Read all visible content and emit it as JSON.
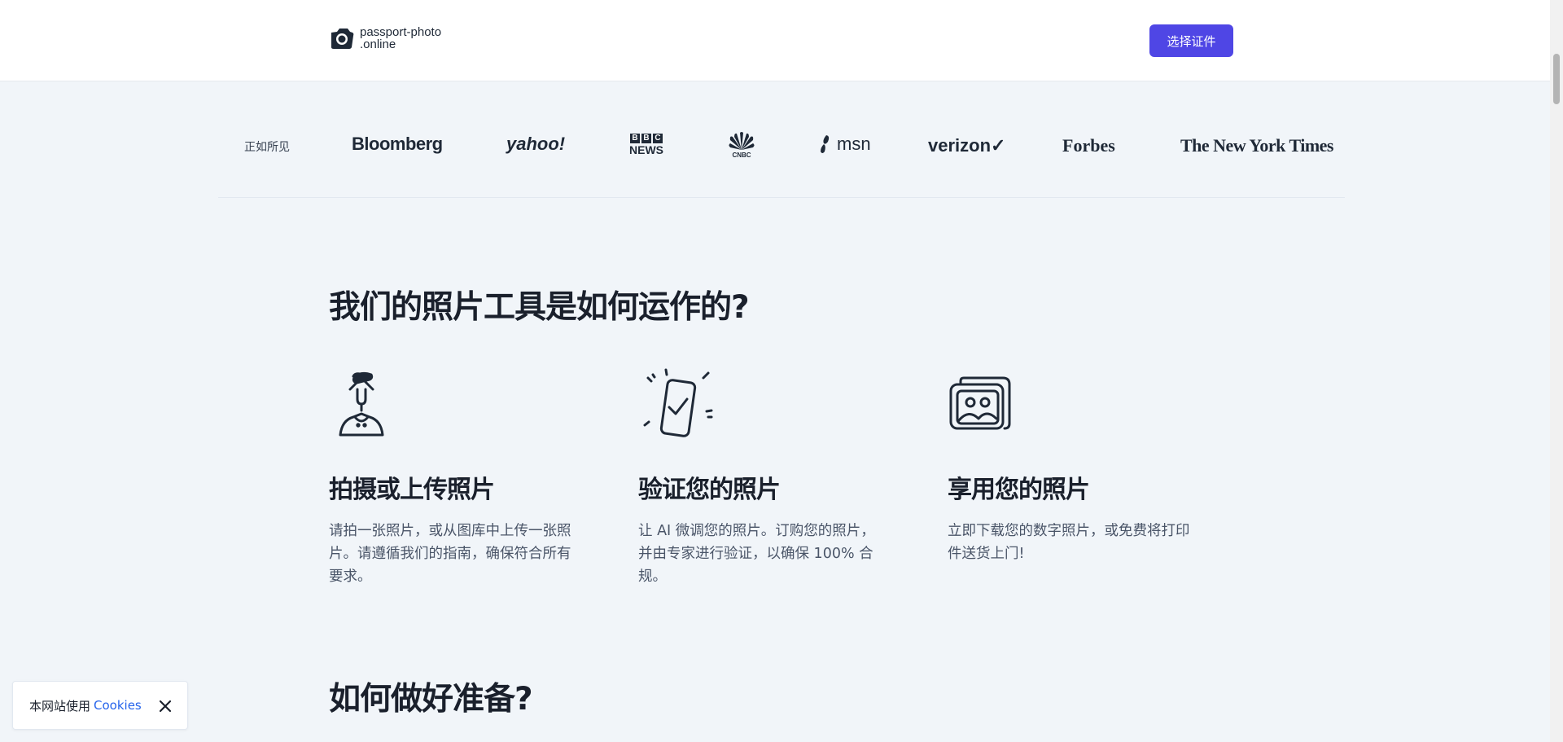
{
  "header": {
    "logo_line1": "passport-photo",
    "logo_line2": ".online",
    "cta_label": "选择证件"
  },
  "press": {
    "label": "正如所见",
    "logos": {
      "bloomberg": "Bloomberg",
      "yahoo": "yahoo!",
      "bbc_letters": [
        "B",
        "B",
        "C"
      ],
      "bbc_news": "NEWS",
      "cnbc": "CNBC",
      "msn": "msn",
      "verizon": "verizon✓",
      "forbes": "Forbes",
      "nyt": "The New York Times"
    }
  },
  "section_how": {
    "title": "我们的照片工具是如何运作的?",
    "steps": [
      {
        "icon": "person-upload-icon",
        "title": "拍摄或上传照片",
        "desc": "请拍一张照片，或从图库中上传一张照片。请遵循我们的指南，确保符合所有要求。"
      },
      {
        "icon": "phone-check-icon",
        "title": "验证您的照片",
        "desc": "让 AI 微调您的照片。订购您的照片，并由专家进行验证，以确保 100% 合规。"
      },
      {
        "icon": "photo-stack-icon",
        "title": "享用您的照片",
        "desc": "立即下载您的数字照片，或免费将打印件送货上门!"
      }
    ]
  },
  "section_prep": {
    "title": "如何做好准备?"
  },
  "cookie": {
    "text": "本网站使用",
    "link": "Cookies"
  },
  "colors": {
    "accent": "#4f46e5",
    "link": "#2563eb",
    "page_bg": "#f1f5f9"
  }
}
